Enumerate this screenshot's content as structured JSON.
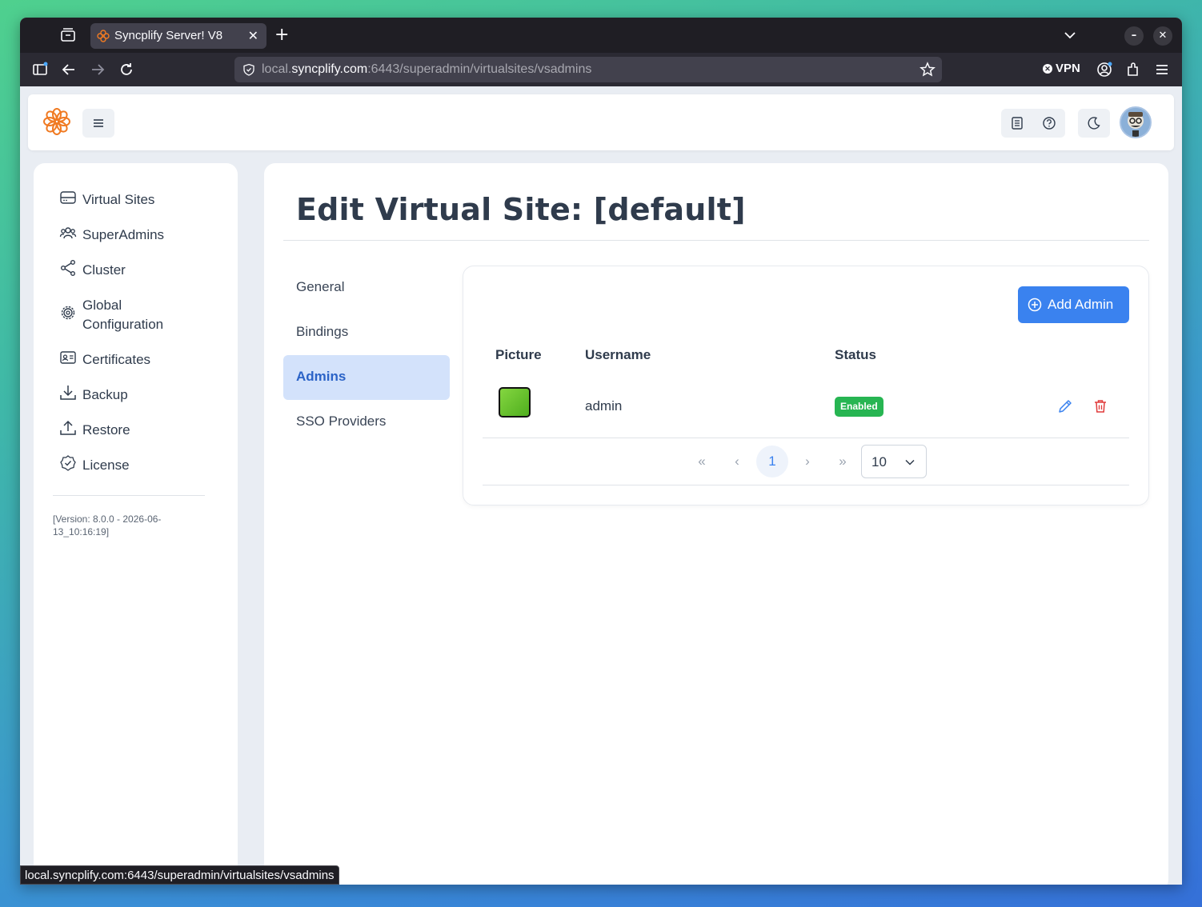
{
  "browser": {
    "tab_title": "Syncplify Server! V8",
    "tab_close": "✕",
    "new_tab": "+",
    "url_prefix": "local.",
    "url_domain": "syncplify.com",
    "url_rest": ":6443/superadmin/virtualsites/vsadmins",
    "vpn_label": "VPN",
    "status_url": "local.syncplify.com:6443/superadmin/virtualsites/vsadmins",
    "win_minimize": "–",
    "win_close": "✕"
  },
  "sidebar": {
    "items": [
      {
        "label": "Virtual Sites",
        "icon": "server-icon"
      },
      {
        "label": "SuperAdmins",
        "icon": "users-icon"
      },
      {
        "label": "Cluster",
        "icon": "share-icon"
      },
      {
        "label": "Global\nConfiguration",
        "icon": "gear-icon"
      },
      {
        "label": "Certificates",
        "icon": "id-card-icon"
      },
      {
        "label": "Backup",
        "icon": "download-icon"
      },
      {
        "label": "Restore",
        "icon": "upload-icon"
      },
      {
        "label": "License",
        "icon": "badge-check-icon"
      }
    ],
    "version": "[Version: 8.0.0 - 2026-06-13_10:16:19]"
  },
  "main": {
    "title": "Edit Virtual Site: [default]",
    "subnav": [
      "General",
      "Bindings",
      "Admins",
      "SSO Providers"
    ],
    "active_subnav": "Admins",
    "add_button": "Add Admin",
    "table": {
      "columns": [
        "Picture",
        "Username",
        "Status"
      ],
      "rows": [
        {
          "username": "admin",
          "status": "Enabled"
        }
      ]
    },
    "pagination": {
      "first": "«",
      "prev": "‹",
      "current_page": "1",
      "next": "›",
      "last": "»",
      "page_size": "10"
    }
  },
  "colors": {
    "accent": "#3a82ef",
    "enabled": "#27b552",
    "delete": "#e03b3b",
    "logo": "#f07a22"
  }
}
